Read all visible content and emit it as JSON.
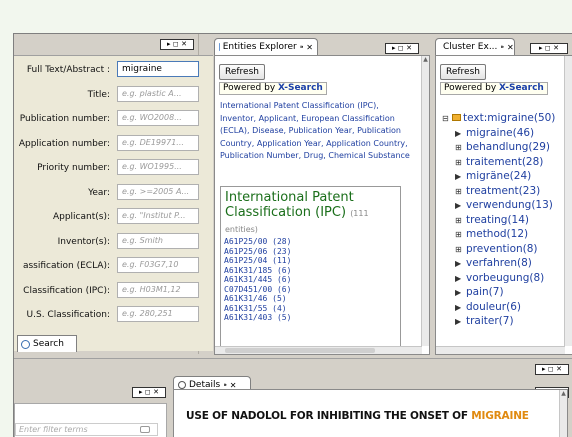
{
  "form": {
    "controls": "▸ ◻ ✕",
    "fields": [
      {
        "label": "Full Text/Abstract :",
        "value": "migraine",
        "placeholder": ""
      },
      {
        "label": "Title:",
        "value": "",
        "placeholder": "e.g. plastic A..."
      },
      {
        "label": "Publication number:",
        "value": "",
        "placeholder": "e.g. WO2008..."
      },
      {
        "label": "Application number:",
        "value": "",
        "placeholder": "e.g. DE19971..."
      },
      {
        "label": "Priority number:",
        "value": "",
        "placeholder": "e.g. WO1995..."
      },
      {
        "label": "Year:",
        "value": "",
        "placeholder": "e.g. >=2005 A..."
      },
      {
        "label": "Applicant(s):",
        "value": "",
        "placeholder": "e.g. \"Institut P..."
      },
      {
        "label": "Inventor(s):",
        "value": "",
        "placeholder": "e.g. Smith"
      },
      {
        "label": "assification (ECLA):",
        "value": "",
        "placeholder": "e.g. F03G7,10"
      },
      {
        "label": "Classification (IPC):",
        "value": "",
        "placeholder": "e.g. H03M1,12"
      },
      {
        "label": "U.S. Classification:",
        "value": "",
        "placeholder": "e.g. 280,251"
      }
    ],
    "search_tab": "Search"
  },
  "entities": {
    "tab_label": "Entities Explorer",
    "tab_pin": "⁍ ✕",
    "controls": "▸ ◻ ✕",
    "refresh": "Refresh",
    "powered_prefix": "Powered by ",
    "powered_brand": "X-Search",
    "description": "International Patent Classification (IPC), Inventor, Applicant, European Classification (ECLA), Disease, Publication Year, Publication Country, Application Year, Application Country, Publication Number, Drug, Chemical Substance",
    "ipc_title": "International Patent Classification (IPC)",
    "ipc_count": "(111 entities)",
    "ipc_items": [
      "A61P25/00 (28)",
      "A61P25/06 (23)",
      "A61P25/04 (11)",
      "A61K31/185 (6)",
      "A61K31/445 (6)",
      "C07D451/00 (6)",
      "A61K31/46 (5)",
      "A61K31/55 (4)",
      "A61K31/403 (5)"
    ]
  },
  "cluster": {
    "tab_label": "Cluster Ex...",
    "tab_pin": "⁍ ✕",
    "controls": "▸ ◻ ✕",
    "refresh": "Refresh",
    "powered_prefix": "Powered by ",
    "powered_brand": "X-Search",
    "root": "text:migraine(50)",
    "items": [
      {
        "marker": "▶",
        "label": "migraine(46)"
      },
      {
        "marker": "⊞",
        "label": "behandlung(29)"
      },
      {
        "marker": "⊞",
        "label": "traitement(28)"
      },
      {
        "marker": "▶",
        "label": "migräne(24)"
      },
      {
        "marker": "⊞",
        "label": "treatment(23)"
      },
      {
        "marker": "▶",
        "label": "verwendung(13)"
      },
      {
        "marker": "⊞",
        "label": "treating(14)"
      },
      {
        "marker": "⊞",
        "label": "method(12)"
      },
      {
        "marker": "⊞",
        "label": "prevention(8)"
      },
      {
        "marker": "▶",
        "label": "verfahren(8)"
      },
      {
        "marker": "▶",
        "label": "vorbeugung(8)"
      },
      {
        "marker": "▶",
        "label": "pain(7)"
      },
      {
        "marker": "▶",
        "label": "douleur(6)"
      },
      {
        "marker": "▶",
        "label": "traiter(7)"
      }
    ]
  },
  "bottom": {
    "controls_right": "▸ ◻ ✕",
    "filter_controls": "▸ ◻ ✕",
    "filter_placeholder": "Enter filter terms",
    "details_tab": "Details",
    "details_pin": "⁍ ✕",
    "details_controls": "▸ ◻ ✕",
    "details_title_prefix": "USE OF NADOLOL FOR INHIBITING THE ONSET OF ",
    "details_title_highlight": "MIGRAINE"
  },
  "colors": {
    "accent_link": "#1f3fa0",
    "highlight": "#e08a10",
    "ipc_title": "#1a6e1a"
  }
}
